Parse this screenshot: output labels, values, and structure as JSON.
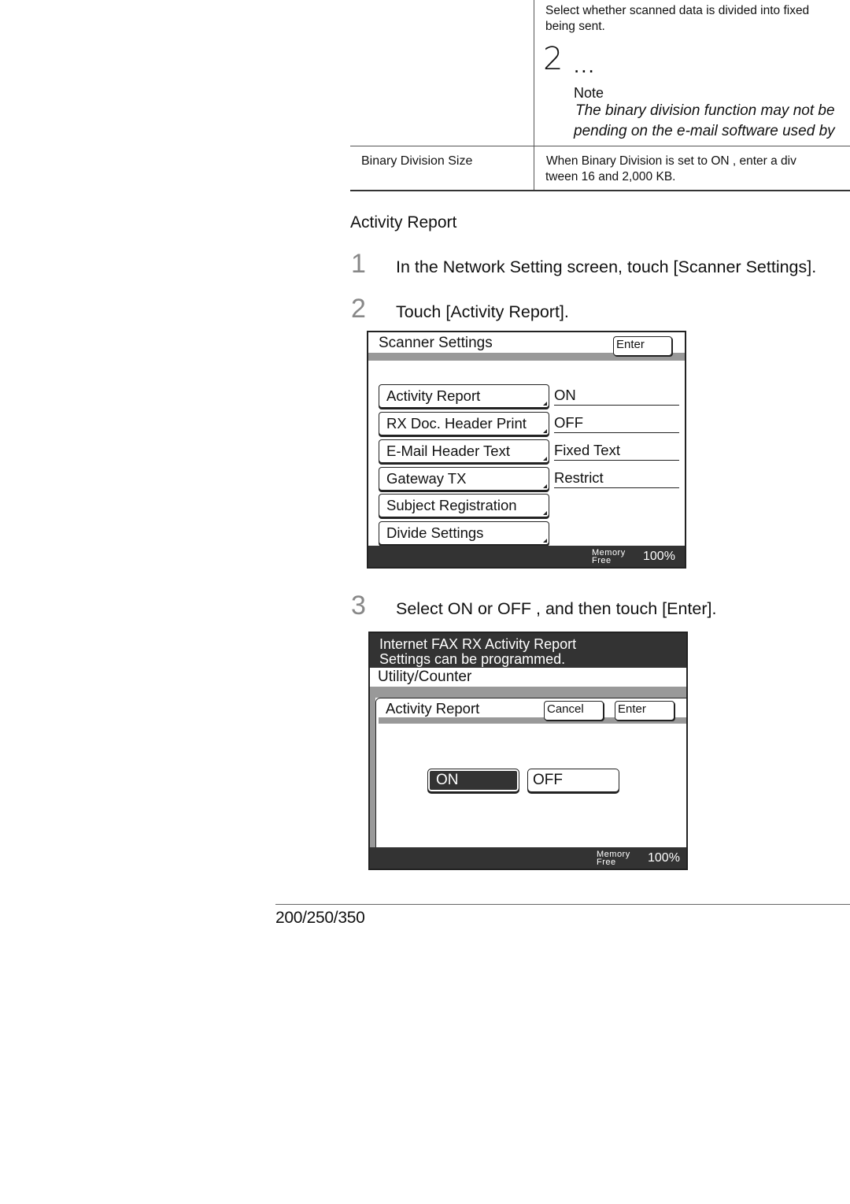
{
  "table": {
    "row1": {
      "desc_line1": "Select whether scanned data is divided into fixed",
      "desc_line2": "being sent.",
      "marker_number": "2",
      "marker_dots": "...",
      "note_title": "Note",
      "note_line1": "The binary division function may not be",
      "note_line2": "pending on the e-mail software used by"
    },
    "row2": {
      "label": "Binary Division Size",
      "desc_line1": "When  Binary Division   is set to  ON , enter a div",
      "desc_line2": "tween 16 and 2,000 KB."
    }
  },
  "section": {
    "title": "Activity Report",
    "steps": [
      {
        "number": "1",
        "text": "In the Network Setting screen, touch [Scanner Settings]."
      },
      {
        "number": "2",
        "text": "Touch [Activity Report]."
      },
      {
        "number": "3",
        "text": "Select  ON  or  OFF , and then touch [Enter]."
      }
    ]
  },
  "panel1": {
    "title": "Scanner Settings",
    "enter_label": "Enter",
    "items": [
      {
        "label": "Activity Report",
        "value": "ON"
      },
      {
        "label": "RX Doc. Header Print",
        "value": "OFF"
      },
      {
        "label": "E-Mail Header Text",
        "value": "Fixed Text"
      },
      {
        "label": "Gateway TX",
        "value": "Restrict"
      },
      {
        "label": "Subject Registration",
        "value": ""
      },
      {
        "label": "Divide Settings",
        "value": ""
      }
    ],
    "memory_label_1": "Memory",
    "memory_label_2": "Free",
    "memory_value": "100%"
  },
  "panel2": {
    "message_line1": "Internet FAX RX Activity Report",
    "message_line2": "Settings can be programmed.",
    "breadcrumb": "Utility/Counter",
    "inner_title": "Activity Report",
    "cancel_label": "Cancel",
    "enter_label": "Enter",
    "on_label": "ON",
    "off_label": "OFF",
    "selected": "ON",
    "memory_label_1": "Memory",
    "memory_label_2": "Free",
    "memory_value": "100%"
  },
  "footer": {
    "model": "200/250/350"
  }
}
